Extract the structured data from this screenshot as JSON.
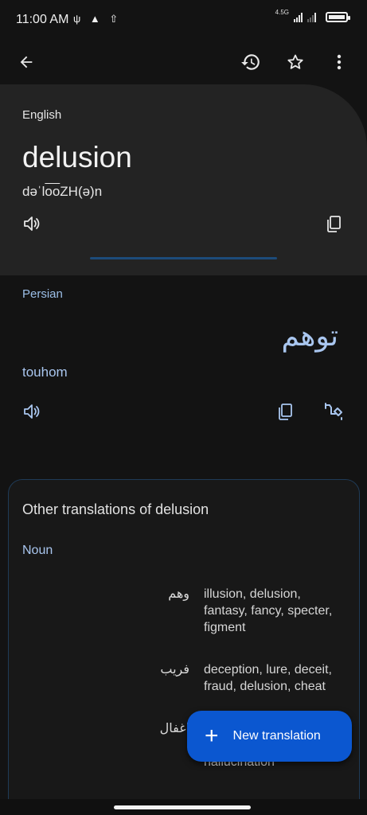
{
  "status_bar": {
    "time": "11:00 AM",
    "left_icons": [
      "usb-icon",
      "warning-icon",
      "upload-icon"
    ],
    "network": "4.5G"
  },
  "toolbar": {
    "back_icon": "arrow-left-icon",
    "history_icon": "history-icon",
    "star_icon": "star-icon",
    "menu_icon": "more-vert-icon"
  },
  "source": {
    "language": "English",
    "word": "delusion",
    "phonetic_pre": "dəˈl",
    "phonetic_over": "oo",
    "phonetic_post": "ZH(ə)n"
  },
  "target": {
    "language": "Persian",
    "word": "توهم",
    "transliteration": "touhom"
  },
  "other_translations": {
    "title": "Other translations of delusion",
    "part_of_speech": "Noun",
    "rows": [
      {
        "word": "وهم",
        "synonyms": "illusion, delusion, fantasy, fancy, specter, figment"
      },
      {
        "word": "فریب",
        "synonyms": "deception, lure, deceit, fraud, delusion, cheat"
      },
      {
        "word": "اغفال",
        "synonyms": "hallucination"
      }
    ]
  },
  "fab": {
    "label": "New translation"
  },
  "colors": {
    "background": "#131313",
    "card": "#232323",
    "accent_text": "#a9c6ef",
    "fab": "#0b57d0"
  }
}
